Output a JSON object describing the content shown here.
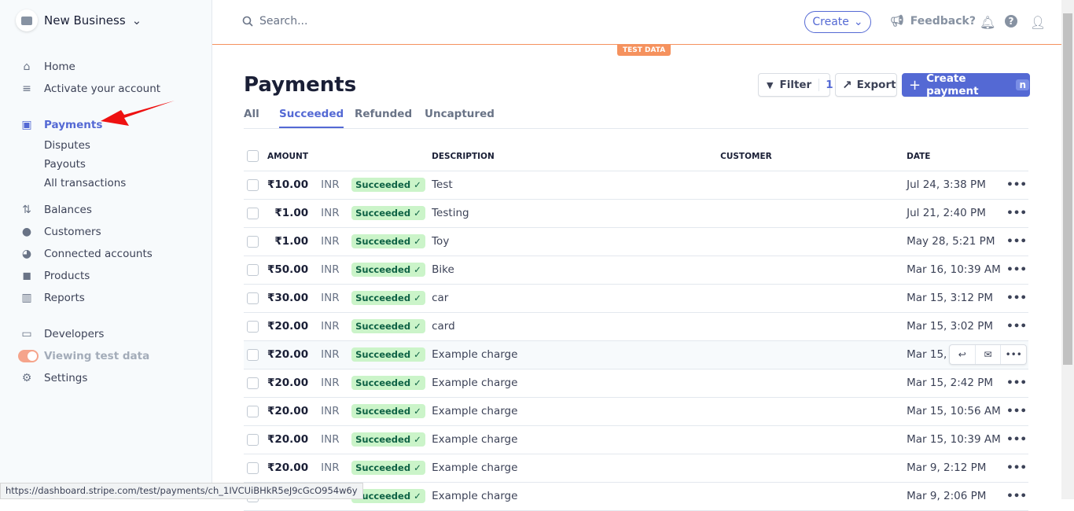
{
  "business": {
    "name": "New Business"
  },
  "sidebar": {
    "items": [
      {
        "label": "Home",
        "icon": "home-icon"
      },
      {
        "label": "Activate your account",
        "icon": "checklist-icon"
      },
      {
        "label": "Payments",
        "icon": "payments-icon",
        "active": true
      },
      {
        "label": "Disputes"
      },
      {
        "label": "Payouts"
      },
      {
        "label": "All transactions"
      },
      {
        "label": "Balances",
        "icon": "balances-icon"
      },
      {
        "label": "Customers",
        "icon": "customer-icon"
      },
      {
        "label": "Connected accounts",
        "icon": "connected-icon"
      },
      {
        "label": "Products",
        "icon": "box-icon"
      },
      {
        "label": "Reports",
        "icon": "reports-icon"
      },
      {
        "label": "Developers",
        "icon": "terminal-icon"
      },
      {
        "label": "Viewing test data",
        "toggle": true
      },
      {
        "label": "Settings",
        "icon": "gear-icon"
      }
    ]
  },
  "header": {
    "search_placeholder": "Search...",
    "create": "Create",
    "feedback": "Feedback?"
  },
  "test_badge": "TEST DATA",
  "page": {
    "title": "Payments",
    "filter": "Filter",
    "filter_count": "1",
    "export": "Export",
    "create_payment": "Create payment",
    "create_shortcut": "n"
  },
  "tabs": [
    {
      "label": "All"
    },
    {
      "label": "Succeeded",
      "active": true
    },
    {
      "label": "Refunded"
    },
    {
      "label": "Uncaptured"
    }
  ],
  "table": {
    "headers": {
      "amount": "AMOUNT",
      "description": "DESCRIPTION",
      "customer": "CUSTOMER",
      "date": "DATE"
    },
    "rows": [
      {
        "amount": "₹10.00",
        "currency": "INR",
        "status": "Succeeded",
        "description": "Test",
        "customer": "",
        "date": "Jul 24, 3:38 PM"
      },
      {
        "amount": "₹1.00",
        "currency": "INR",
        "status": "Succeeded",
        "description": "Testing",
        "customer": "",
        "date": "Jul 21, 2:40 PM"
      },
      {
        "amount": "₹1.00",
        "currency": "INR",
        "status": "Succeeded",
        "description": "Toy",
        "customer": "",
        "date": "May 28, 5:21 PM"
      },
      {
        "amount": "₹50.00",
        "currency": "INR",
        "status": "Succeeded",
        "description": "Bike",
        "customer": "",
        "date": "Mar 16, 10:39 AM"
      },
      {
        "amount": "₹30.00",
        "currency": "INR",
        "status": "Succeeded",
        "description": "car",
        "customer": "",
        "date": "Mar 15, 3:12 PM"
      },
      {
        "amount": "₹20.00",
        "currency": "INR",
        "status": "Succeeded",
        "description": "card",
        "customer": "",
        "date": "Mar 15, 3:02 PM"
      },
      {
        "amount": "₹20.00",
        "currency": "INR",
        "status": "Succeeded",
        "description": "Example charge",
        "customer": "",
        "date": "Mar 15, 2"
      },
      {
        "amount": "₹20.00",
        "currency": "INR",
        "status": "Succeeded",
        "description": "Example charge",
        "customer": "",
        "date": "Mar 15, 2:42 PM"
      },
      {
        "amount": "₹20.00",
        "currency": "INR",
        "status": "Succeeded",
        "description": "Example charge",
        "customer": "",
        "date": "Mar 15, 10:56 AM"
      },
      {
        "amount": "₹20.00",
        "currency": "INR",
        "status": "Succeeded",
        "description": "Example charge",
        "customer": "",
        "date": "Mar 15, 10:39 AM"
      },
      {
        "amount": "₹20.00",
        "currency": "INR",
        "status": "Succeeded",
        "description": "Example charge",
        "customer": "",
        "date": "Mar 9, 2:12 PM"
      },
      {
        "amount": "",
        "currency": "R",
        "status": "Succeeded",
        "description": "Example charge",
        "customer": "",
        "date": "Mar 9, 2:06 PM"
      }
    ]
  },
  "status_url": "https://dashboard.stripe.com/test/payments/ch_1IVCUiBHkR5eJ9cGcO954w6y",
  "colors": {
    "accent": "#5469d4",
    "test": "#f5925e",
    "success_bg": "#cbf4c9"
  }
}
